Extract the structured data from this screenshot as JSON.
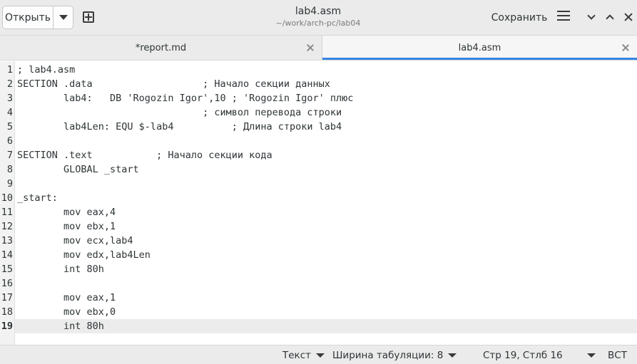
{
  "header": {
    "open_label": "Открыть",
    "title": "lab4.asm",
    "subtitle": "~/work/arch-pc/lab04",
    "save_label": "Сохранить"
  },
  "tabs": [
    {
      "label": "*report.md",
      "active": false
    },
    {
      "label": "lab4.asm",
      "active": true
    }
  ],
  "editor": {
    "current_line": 19,
    "lines": [
      {
        "n": "1",
        "text": "; lab4.asm"
      },
      {
        "n": "2",
        "text": "SECTION .data                   ; Начало секции данных"
      },
      {
        "n": "3",
        "text": "        lab4:   DB 'Rogozin Igor',10 ; 'Rogozin Igor' плюс"
      },
      {
        "n": "4",
        "text": "                                ; символ перевода строки"
      },
      {
        "n": "5",
        "text": "        lab4Len: EQU $-lab4          ; Длина строки lab4"
      },
      {
        "n": "6",
        "text": ""
      },
      {
        "n": "7",
        "text": "SECTION .text           ; Начало секции кода"
      },
      {
        "n": "8",
        "text": "        GLOBAL _start"
      },
      {
        "n": "9",
        "text": ""
      },
      {
        "n": "10",
        "text": "_start:"
      },
      {
        "n": "11",
        "text": "        mov eax,4"
      },
      {
        "n": "12",
        "text": "        mov ebx,1"
      },
      {
        "n": "13",
        "text": "        mov ecx,lab4"
      },
      {
        "n": "14",
        "text": "        mov edx,lab4Len"
      },
      {
        "n": "15",
        "text": "        int 80h"
      },
      {
        "n": "16",
        "text": ""
      },
      {
        "n": "17",
        "text": "        mov eax,1"
      },
      {
        "n": "18",
        "text": "        mov ebx,0"
      },
      {
        "n": "19",
        "text": "        int 80h"
      }
    ]
  },
  "statusbar": {
    "syntax": "Текст",
    "tab_width": "Ширина табуляции: 8",
    "position": "Стр 19, Стлб 16",
    "insert_mode": "ВСТ"
  }
}
